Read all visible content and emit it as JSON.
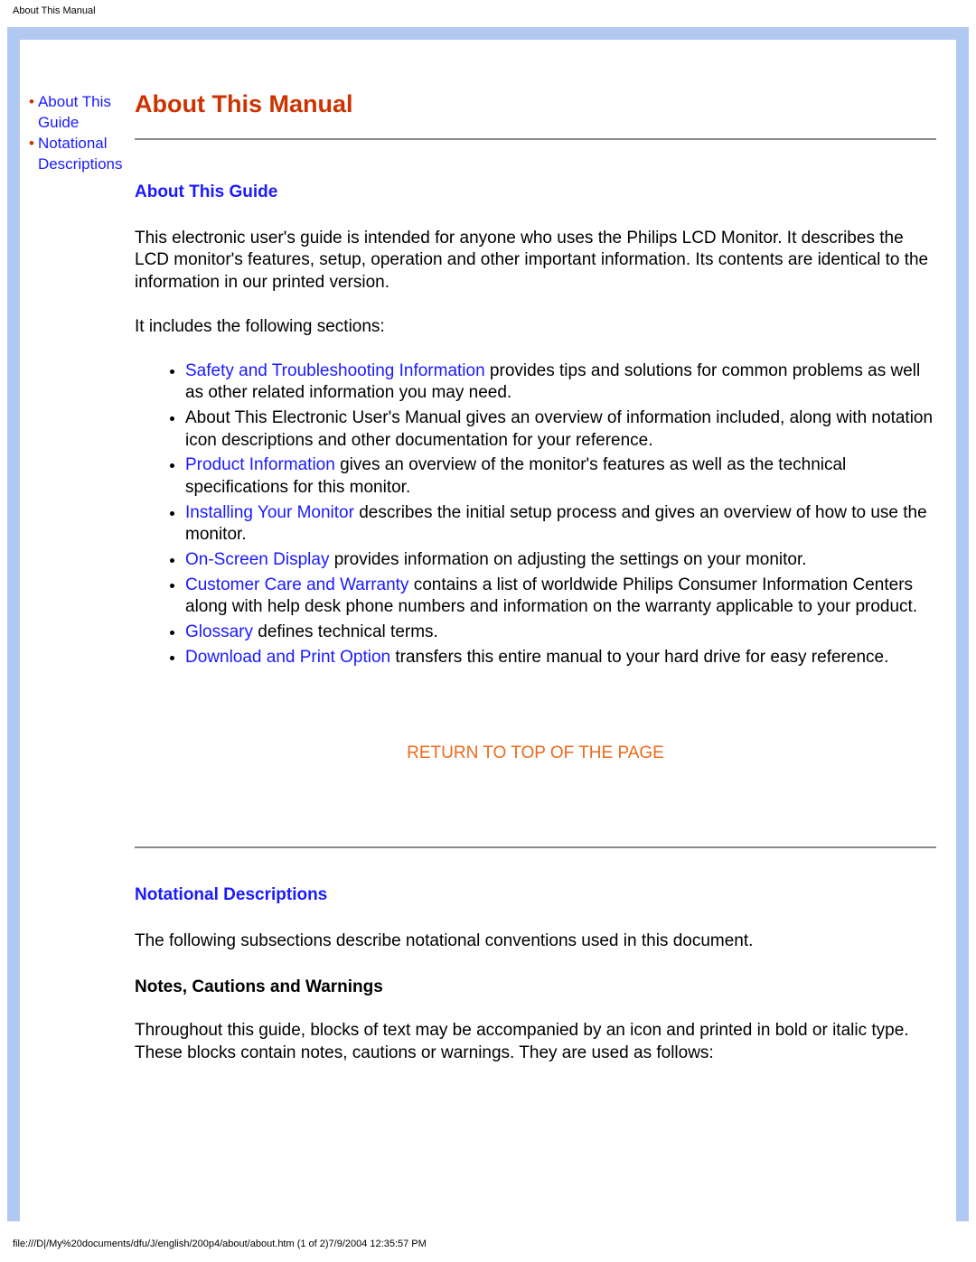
{
  "header_small": "About This Manual",
  "nav": {
    "item0": "About This Guide",
    "item1": "Notational Descriptions"
  },
  "title": "About This Manual",
  "section1_heading": "About This Guide",
  "para1": "This electronic user's guide is intended for anyone who uses the Philips LCD Monitor. It describes the LCD monitor's features, setup, operation and other important information. Its contents are identical to the information in our printed version.",
  "para2": "It includes the following sections:",
  "list": {
    "i0_link": "Safety and Troubleshooting Information",
    "i0_rest": " provides tips and solutions for common problems as well as other related information you may need.",
    "i1_full": "About This Electronic User's Manual gives an overview of information included, along with notation icon descriptions and other documentation for your reference.",
    "i2_link": "Product Information",
    "i2_rest": " gives an overview of the monitor's features as well as the technical specifications for this monitor.",
    "i3_link": "Installing Your Monitor",
    "i3_rest": " describes the initial setup process and gives an overview of how to use the monitor.",
    "i4_link": "On-Screen Display",
    "i4_rest": " provides information on adjusting the settings on your monitor.",
    "i5_link": "Customer Care and Warranty",
    "i5_rest": " contains a list of worldwide Philips Consumer Information Centers along with help desk phone numbers and information on the warranty applicable to your product.",
    "i6_link": "Glossary",
    "i6_rest": " defines technical terms.",
    "i7_link": "Download and Print Option",
    "i7_rest": " transfers this entire manual to your hard drive for easy reference."
  },
  "return_top": "RETURN TO TOP OF THE PAGE",
  "section2_heading": "Notational Descriptions",
  "para3": "The following subsections describe notational conventions used in this document.",
  "sub_heading": "Notes, Cautions and Warnings",
  "para4": "Throughout this guide, blocks of text may be accompanied by an icon and printed in bold or italic type. These blocks contain notes, cautions or warnings. They are used as follows:",
  "footer": "file:///D|/My%20documents/dfu/J/english/200p4/about/about.htm (1 of 2)7/9/2004 12:35:57 PM"
}
